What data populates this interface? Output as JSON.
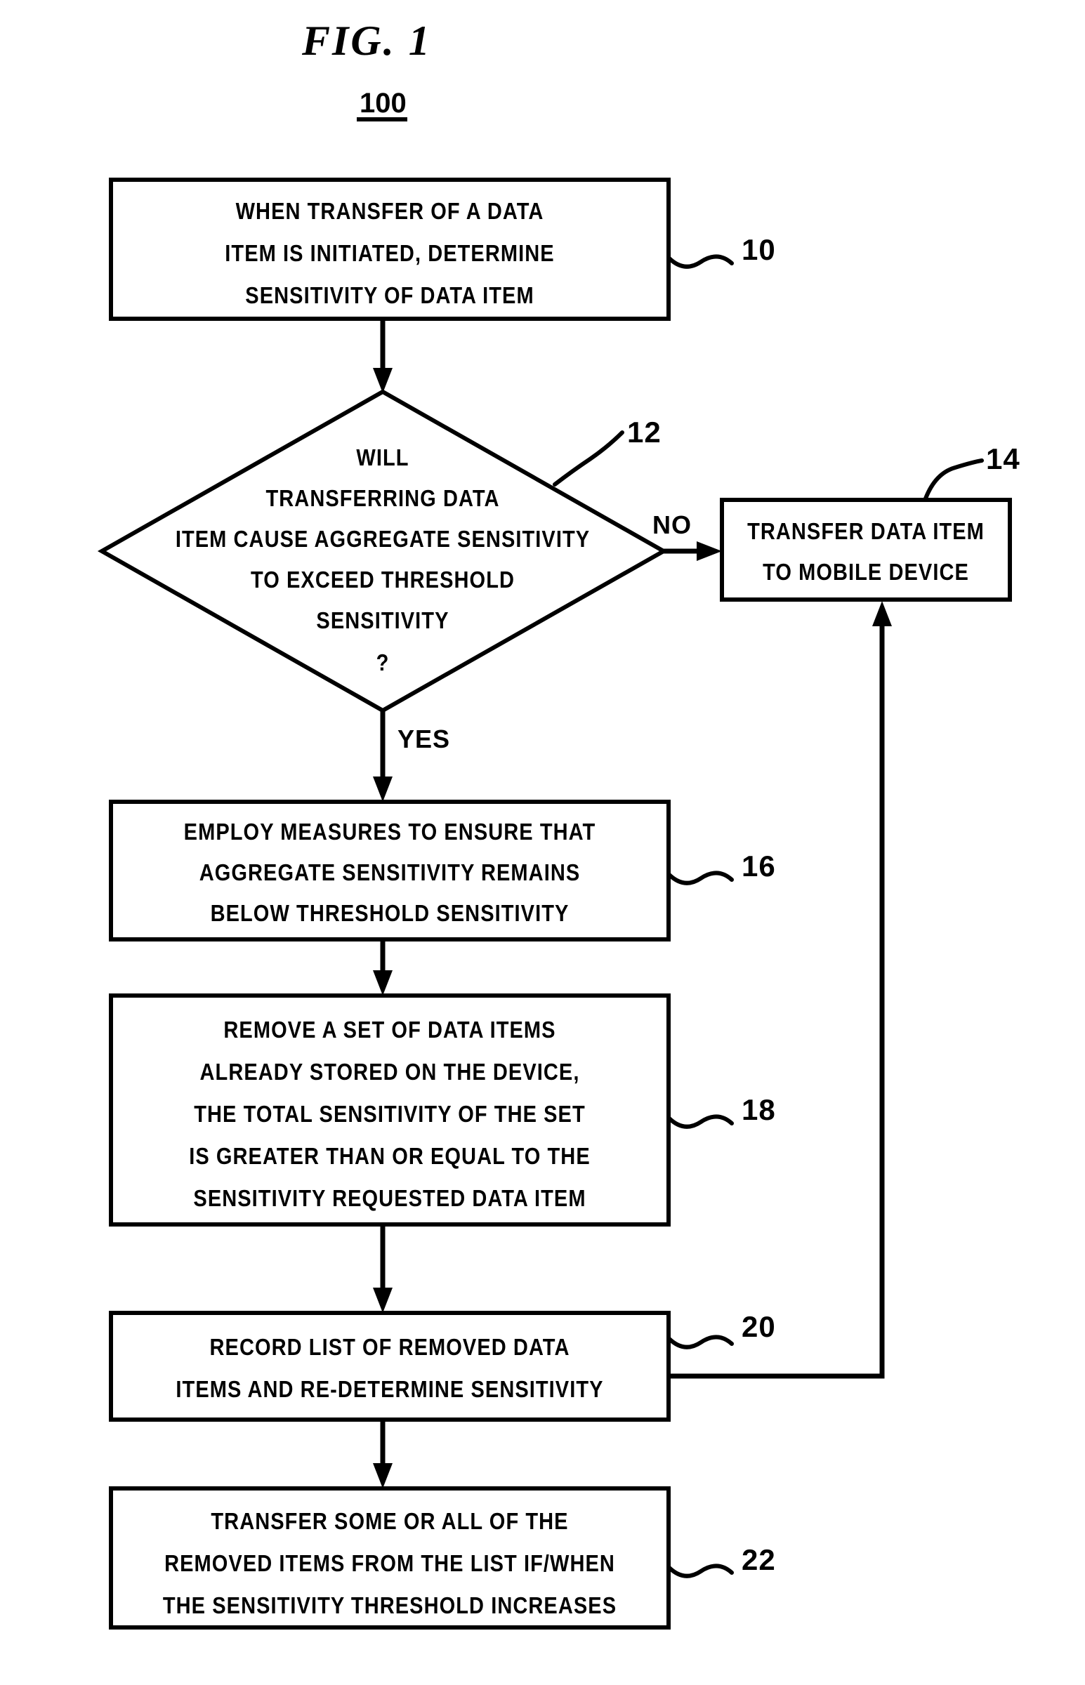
{
  "figure": {
    "title": "FIG.  1",
    "number": "100"
  },
  "branch_labels": {
    "no": "NO",
    "yes": "YES"
  },
  "nodes": [
    {
      "id": "step-10",
      "type": "process",
      "ref": "10",
      "lines": [
        "WHEN TRANSFER OF A DATA",
        "ITEM IS INITIATED, DETERMINE",
        "SENSITIVITY OF DATA ITEM"
      ]
    },
    {
      "id": "decision-12",
      "type": "decision",
      "ref": "12",
      "lines": [
        "WILL",
        "TRANSFERRING DATA",
        "ITEM CAUSE AGGREGATE SENSITIVITY",
        "TO EXCEED THRESHOLD",
        "SENSITIVITY",
        "?"
      ]
    },
    {
      "id": "step-14",
      "type": "process",
      "ref": "14",
      "lines": [
        "TRANSFER DATA ITEM",
        "TO MOBILE DEVICE"
      ]
    },
    {
      "id": "step-16",
      "type": "process",
      "ref": "16",
      "lines": [
        "EMPLOY MEASURES TO ENSURE THAT",
        "AGGREGATE SENSITIVITY REMAINS",
        "BELOW THRESHOLD SENSITIVITY"
      ]
    },
    {
      "id": "step-18",
      "type": "process",
      "ref": "18",
      "lines": [
        "REMOVE A SET OF DATA ITEMS",
        "ALREADY STORED ON THE DEVICE,",
        "THE TOTAL SENSITIVITY OF THE SET",
        "IS GREATER THAN OR EQUAL TO THE",
        "SENSITIVITY REQUESTED DATA ITEM"
      ]
    },
    {
      "id": "step-20",
      "type": "process",
      "ref": "20",
      "lines": [
        "RECORD LIST OF REMOVED DATA",
        "ITEMS AND RE-DETERMINE SENSITIVITY"
      ]
    },
    {
      "id": "step-22",
      "type": "process",
      "ref": "22",
      "lines": [
        "TRANSFER SOME OR ALL OF THE",
        "REMOVED ITEMS FROM THE LIST IF/WHEN",
        "THE SENSITIVITY THRESHOLD INCREASES"
      ]
    }
  ],
  "colors": {
    "ink": "#000000",
    "paper": "#ffffff"
  }
}
